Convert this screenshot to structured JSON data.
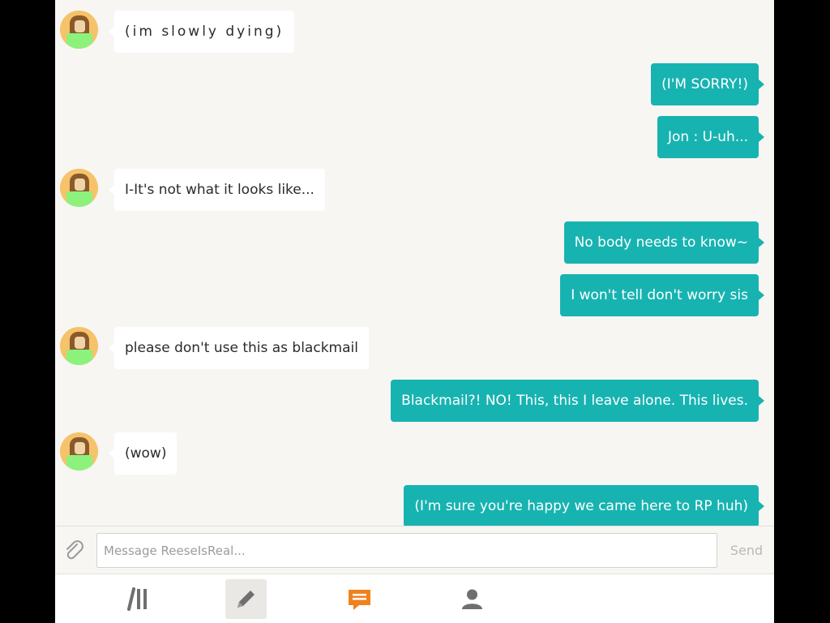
{
  "messages": [
    {
      "side": "in",
      "text": "(im slowly dying)"
    },
    {
      "side": "out",
      "text": "(I'M SORRY!)"
    },
    {
      "side": "out",
      "text": "Jon : U-uh..."
    },
    {
      "side": "in",
      "text": "I-It's not what it looks like..."
    },
    {
      "side": "out",
      "text": "No body needs to know~"
    },
    {
      "side": "out",
      "text": "I won't tell don't worry sis"
    },
    {
      "side": "in",
      "text": "please don't use this as blackmail"
    },
    {
      "side": "out",
      "text": "Blackmail?! NO! This, this I leave alone. This lives."
    },
    {
      "side": "in",
      "text": "(wow)"
    },
    {
      "side": "out",
      "text": "(I'm sure you're happy we came here to RP huh)"
    }
  ],
  "composer": {
    "placeholder": "Message ReeseIsReal...",
    "value": "",
    "send_label": "Send",
    "attach_icon": "paperclip-icon"
  },
  "tabs": [
    {
      "icon": "library-icon",
      "active": false
    },
    {
      "icon": "pencil-icon",
      "active": true
    },
    {
      "icon": "chat-icon",
      "active": false,
      "color": "#f0821e"
    },
    {
      "icon": "profile-icon",
      "active": false
    }
  ],
  "colors": {
    "outgoing_bubble": "#17b3b1",
    "incoming_bubble": "#ffffff",
    "background": "#f7f6f3",
    "accent": "#f0821e"
  }
}
